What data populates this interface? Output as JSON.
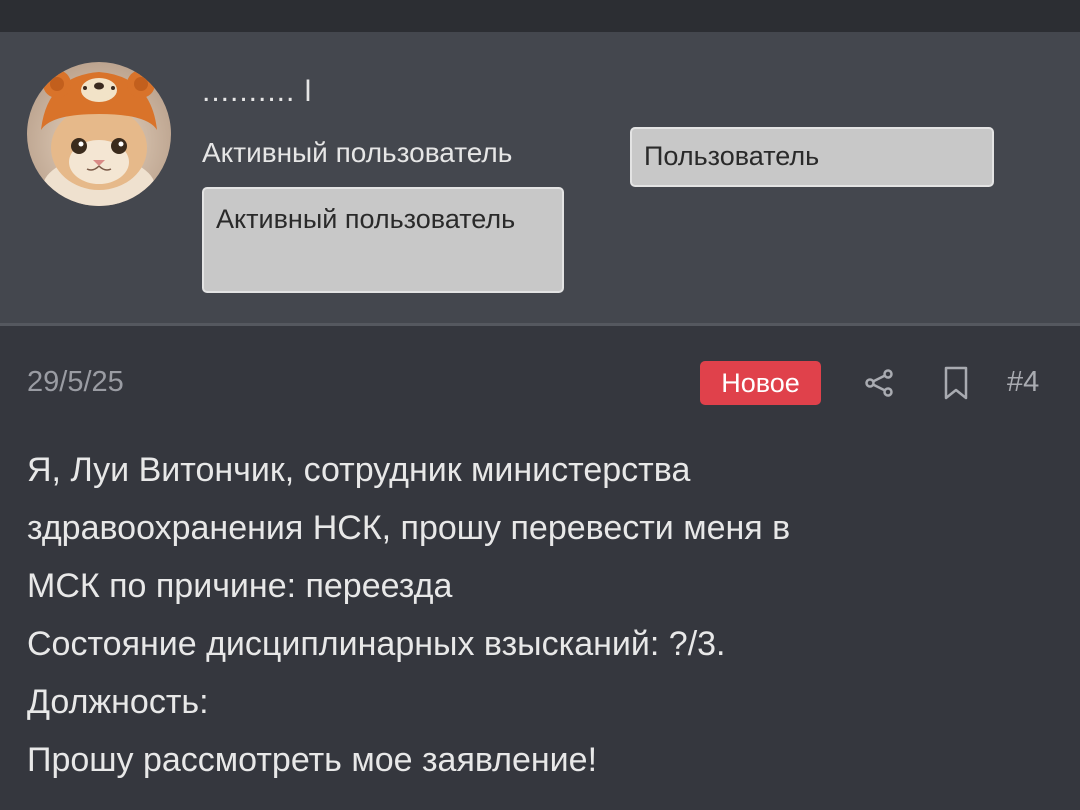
{
  "user": {
    "name": ".......... l",
    "title": "Активный пользователь",
    "banners": [
      "Пользователь",
      "Активный пользователь"
    ],
    "avatar_icon": "cat-avatar-icon"
  },
  "post": {
    "date": "29/5/25",
    "badge": "Новое",
    "badge_color": "#e0414b",
    "share_icon": "share-icon",
    "bookmark_icon": "bookmark-icon",
    "number": "#4",
    "lines": [
      "Я, Луи Витончик, сотрудник министерства",
      "здравоохранения НСК, прошу перевести меня в",
      "МСК по причине: переезда",
      "Состояние дисциплинарных взысканий: ?/3.",
      "Должность:",
      "Прошу рассмотреть мое заявление!"
    ]
  }
}
